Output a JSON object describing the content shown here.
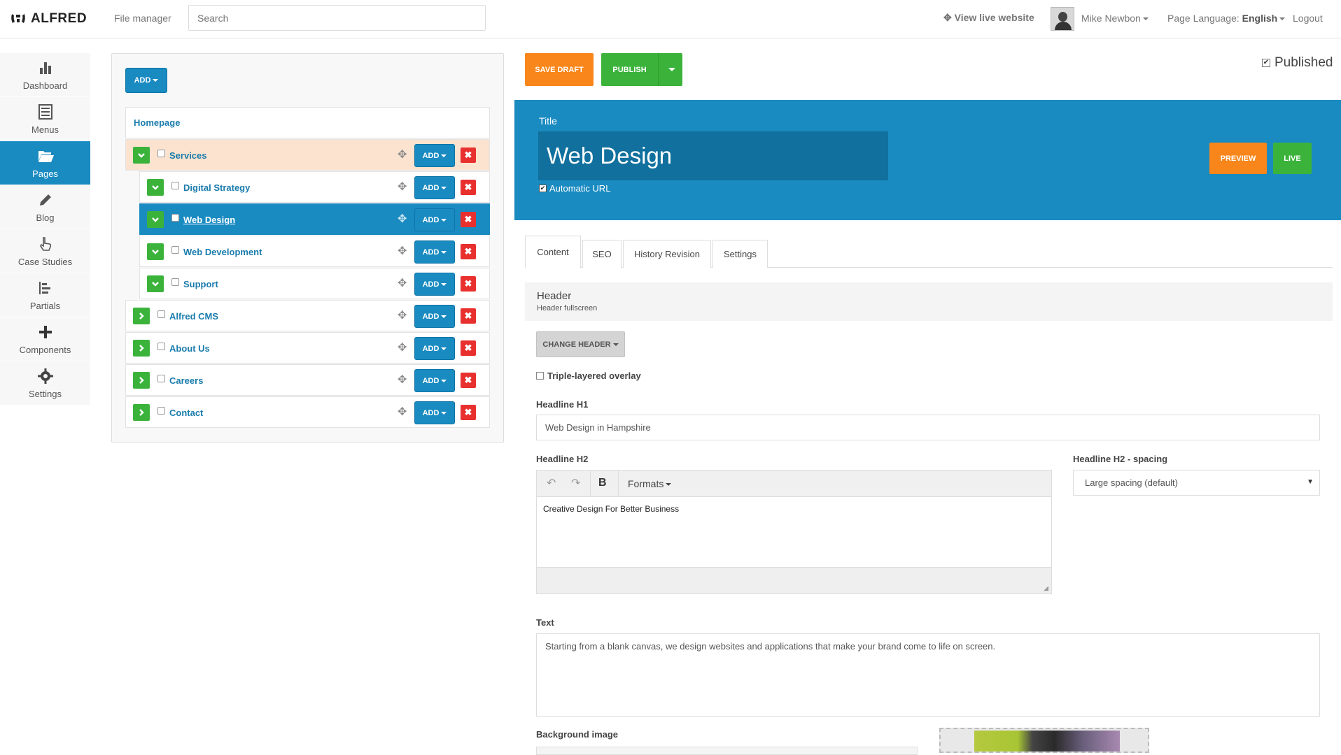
{
  "topbar": {
    "logo": "ALFRED",
    "file_manager": "File manager",
    "search_placeholder": "Search",
    "view_live": "View live website",
    "user": "Mike Newbon",
    "language_label": "Page Language:",
    "language_value": "English",
    "logout": "Logout"
  },
  "sidebar": {
    "items": [
      {
        "label": "Dashboard",
        "icon": "bar-chart-icon"
      },
      {
        "label": "Menus",
        "icon": "list-icon"
      },
      {
        "label": "Pages",
        "icon": "folder-open-icon",
        "active": true
      },
      {
        "label": "Blog",
        "icon": "pencil-icon"
      },
      {
        "label": "Case Studies",
        "icon": "hand-pointer-icon"
      },
      {
        "label": "Partials",
        "icon": "partials-icon"
      },
      {
        "label": "Components",
        "icon": "plus-icon"
      },
      {
        "label": "Settings",
        "icon": "gear-icon"
      }
    ]
  },
  "tree": {
    "add_label": "ADD",
    "homepage": "Homepage",
    "row_add_label": "ADD",
    "rows": [
      {
        "label": "Services",
        "expanded": true,
        "level": 0
      },
      {
        "label": "Digital Strategy",
        "expanded": true,
        "level": 1
      },
      {
        "label": "Web Design",
        "expanded": true,
        "level": 1,
        "selected": true
      },
      {
        "label": "Web Development",
        "expanded": true,
        "level": 1
      },
      {
        "label": "Support",
        "expanded": true,
        "level": 1
      },
      {
        "label": "Alfred CMS",
        "expanded": false,
        "level": 0
      },
      {
        "label": "About Us",
        "expanded": false,
        "level": 0
      },
      {
        "label": "Careers",
        "expanded": false,
        "level": 0
      },
      {
        "label": "Contact",
        "expanded": false,
        "level": 0
      }
    ]
  },
  "editor": {
    "save_draft": "SAVE DRAFT",
    "publish": "PUBLISH",
    "published_label": "Published",
    "title_label": "Title",
    "title_value": "Web Design",
    "automatic_url": "Automatic URL",
    "preview": "PREVIEW",
    "live": "LIVE",
    "tabs": [
      "Content",
      "SEO",
      "History Revision",
      "Settings"
    ],
    "section_title": "Header",
    "section_sub": "Header fullscreen",
    "change_header": "CHANGE HEADER",
    "triple_overlay": "Triple-layered overlay",
    "h1_label": "Headline H1",
    "h1_value": "Web Design in Hampshire",
    "h2_label": "Headline H2",
    "h2_formats": "Formats",
    "h2_bold": "B",
    "h2_value": "Creative Design For Better Business",
    "h2_spacing_label": "Headline H2 - spacing",
    "h2_spacing_value": "Large spacing (default)",
    "text_label": "Text",
    "text_value": "Starting from a blank canvas, we design websites and applications that make your brand come to life on screen.",
    "bg_label": "Background image"
  },
  "colors": {
    "primary": "#1a8bc1",
    "orange": "#f8861a",
    "green": "#3bb33b",
    "red": "#e8302e"
  }
}
